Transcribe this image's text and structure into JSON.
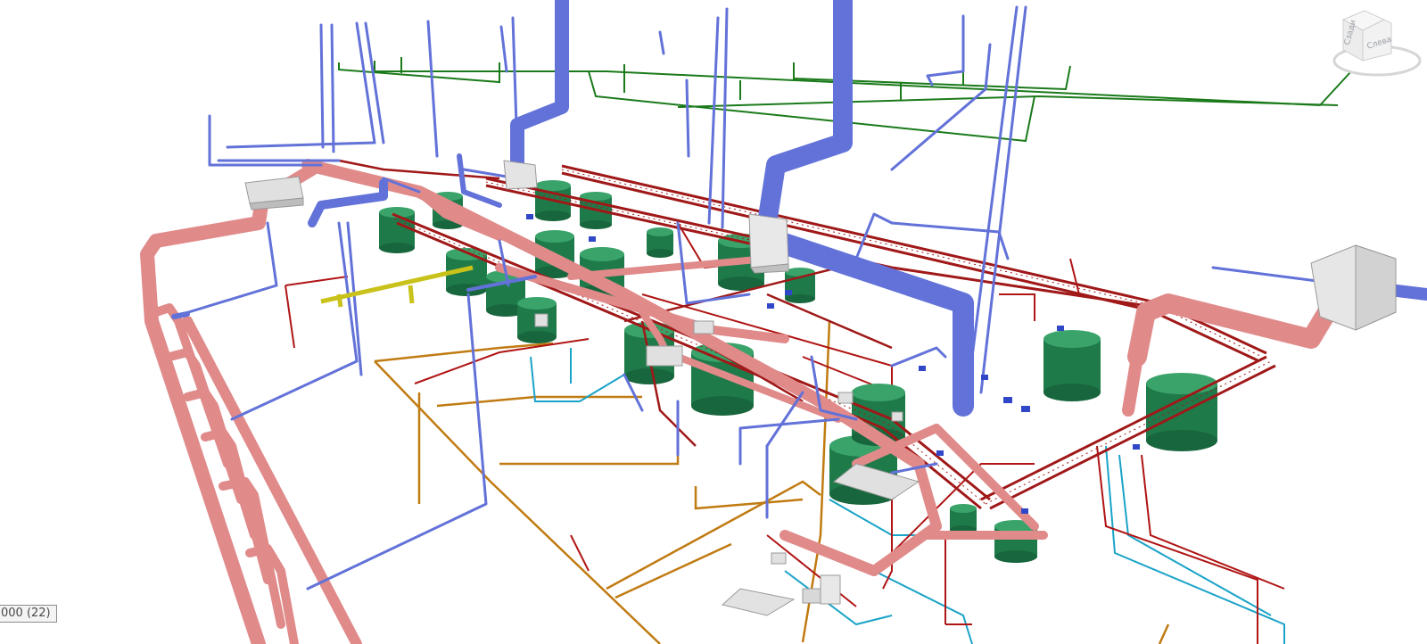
{
  "viewport": {
    "background": "#ffffff"
  },
  "viewcube": {
    "face_front": "Слева",
    "face_side": "Сзади",
    "face_color": "#f2f2f2",
    "edge_color": "#c8c8c8"
  },
  "status": {
    "scale_label": "000 (22)"
  },
  "systems": {
    "supply_air_duct": {
      "icon": "duct",
      "color": "#6272d8"
    },
    "exhaust_duct": {
      "icon": "duct",
      "color": "#e08a8a"
    },
    "cable_tray": {
      "icon": "tray",
      "color": "#a01818"
    },
    "water_pipe": {
      "icon": "pipe",
      "color": "#1aa3c8"
    },
    "drain_pipe": {
      "icon": "pipe",
      "color": "#c07b12"
    },
    "sprinkler_pipe": {
      "icon": "pipe",
      "color": "#1a7a1a"
    },
    "gas_pipe": {
      "icon": "pipe",
      "color": "#c8c21a"
    },
    "tank": {
      "icon": "tank",
      "color": "#1f7a4a"
    },
    "equipment": {
      "icon": "box",
      "color": "#d8d8d8"
    }
  }
}
